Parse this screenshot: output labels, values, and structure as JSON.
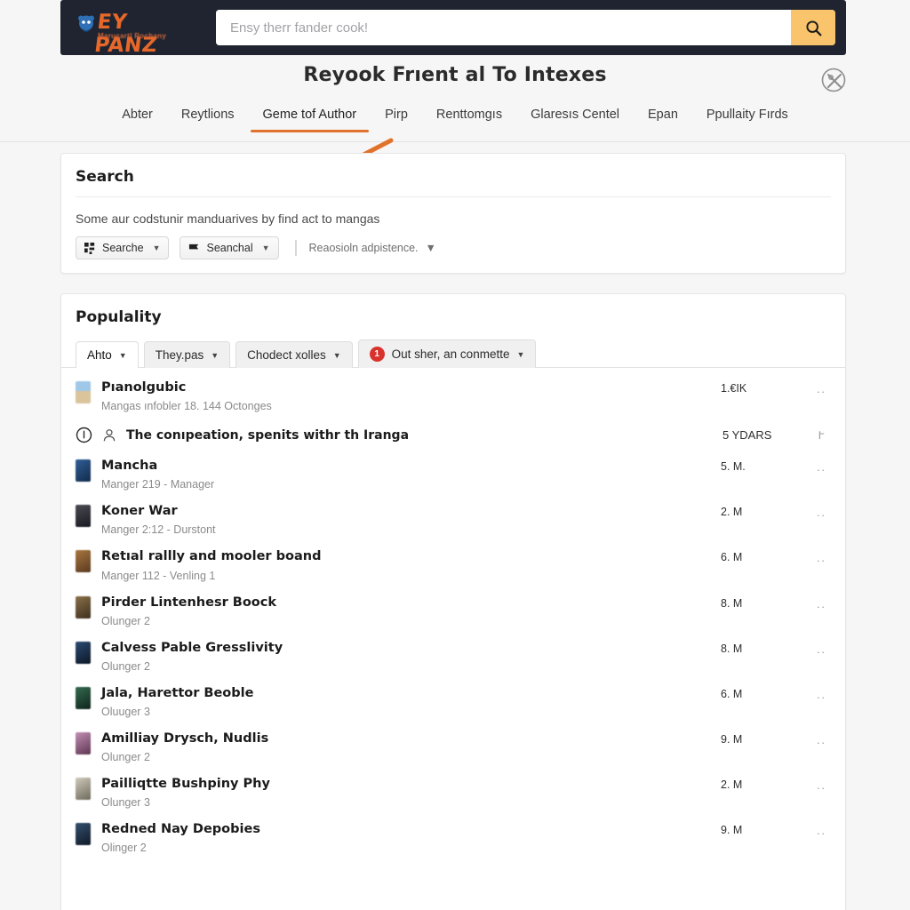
{
  "header": {
    "logo_text": "EY PANZ",
    "logo_sub": "Marucartl Rochany",
    "search": {
      "placeholder": "Ensy therr fander cook!",
      "value": "",
      "button_icon": "search-icon",
      "button_color": "#f9c46b"
    }
  },
  "page_title": "Reyook Frıent al To Intexes",
  "tool_icon": "crossed-tools-icon",
  "nav": {
    "items": [
      {
        "label": "Abter",
        "active": false
      },
      {
        "label": "Reytlions",
        "active": false
      },
      {
        "label": "Geme tof Author",
        "active": true
      },
      {
        "label": "Pirp",
        "active": false
      },
      {
        "label": "Renttomgıs",
        "active": false
      },
      {
        "label": "Glaresıs Centel",
        "active": false
      },
      {
        "label": "Epan",
        "active": false
      },
      {
        "label": "Ppullaity Fırds",
        "active": false
      }
    ],
    "active_accent": "#e0722c"
  },
  "search_card": {
    "heading": "Search",
    "description": "Some aur codstunir manduarives by find act to mangas",
    "buttons": [
      {
        "label": "Searche",
        "icon": "grid-icon",
        "caret": "▼"
      },
      {
        "label": "Seanchal",
        "icon": "flag-icon",
        "caret": "▼"
      }
    ],
    "dropdown": {
      "label": "Reaosioln adpistence.",
      "caret": "▼"
    }
  },
  "popularity_card": {
    "heading": "Populality",
    "tabs": [
      {
        "label": "Ahto",
        "active": true,
        "badge": null
      },
      {
        "label": "They.pas",
        "active": false,
        "badge": null
      },
      {
        "label": "Chodect xolles",
        "active": false,
        "badge": null
      },
      {
        "label": "Out sher, an conmette",
        "active": false,
        "badge": "1"
      }
    ],
    "badge_color": "#d9322c",
    "rows": [
      {
        "type": "item",
        "title": "Pıanolgubic",
        "subtitle": "Mangas ınfobler 18. 144 Octonges",
        "value": "1.€IK",
        "menu": "··",
        "thumb": "#c8b89a"
      },
      {
        "type": "alert",
        "title": "The conıpeation, spenits withr th Iranga",
        "value": "5 YDARS",
        "menu": "Ւ",
        "icons": [
          "info-circle-icon",
          "person-icon"
        ]
      },
      {
        "type": "item",
        "title": "Mancha",
        "subtitle": "Manger 219 - Manager",
        "value": "5. M.",
        "menu": "··",
        "thumb": "#1e3a63"
      },
      {
        "type": "item",
        "title": "Koner War",
        "subtitle": "Manger 2:12 - Durstont",
        "value": "2. M",
        "menu": "··",
        "thumb": "#2b2b33"
      },
      {
        "type": "item",
        "title": "Retıal rallly and mooler boand",
        "subtitle": "Manger 112 - Venling 1",
        "value": "6. M",
        "menu": "··",
        "thumb": "#7d5434"
      },
      {
        "type": "item",
        "title": "Pirder Lintenhesr Boock",
        "subtitle": "Olunger 2",
        "value": "8. M",
        "menu": "··",
        "thumb": "#6b5239"
      },
      {
        "type": "item",
        "title": "Calvess Pable Gresslivity",
        "subtitle": "Olunger 2",
        "value": "8. M",
        "menu": "··",
        "thumb": "#16263f"
      },
      {
        "type": "item",
        "title": "Jala, Harettor Beoble",
        "subtitle": "Oluuger 3",
        "value": "6. M",
        "menu": "··",
        "thumb": "#1d3b30"
      },
      {
        "type": "item",
        "title": "Amilliay Drysch, Nudlis",
        "subtitle": "Olunger 2",
        "value": "9. M",
        "menu": "··",
        "thumb": "#8d5a7a"
      },
      {
        "type": "item",
        "title": "Pailliqtte Bushpiny Phy",
        "subtitle": "Olunger 3",
        "value": "2. M",
        "menu": "··",
        "thumb": "#9a9a8c"
      },
      {
        "type": "item",
        "title": "Redned Nay Depobies",
        "subtitle": "Olinger 2",
        "value": "9. M",
        "menu": "··",
        "thumb": "#23354d"
      }
    ]
  }
}
